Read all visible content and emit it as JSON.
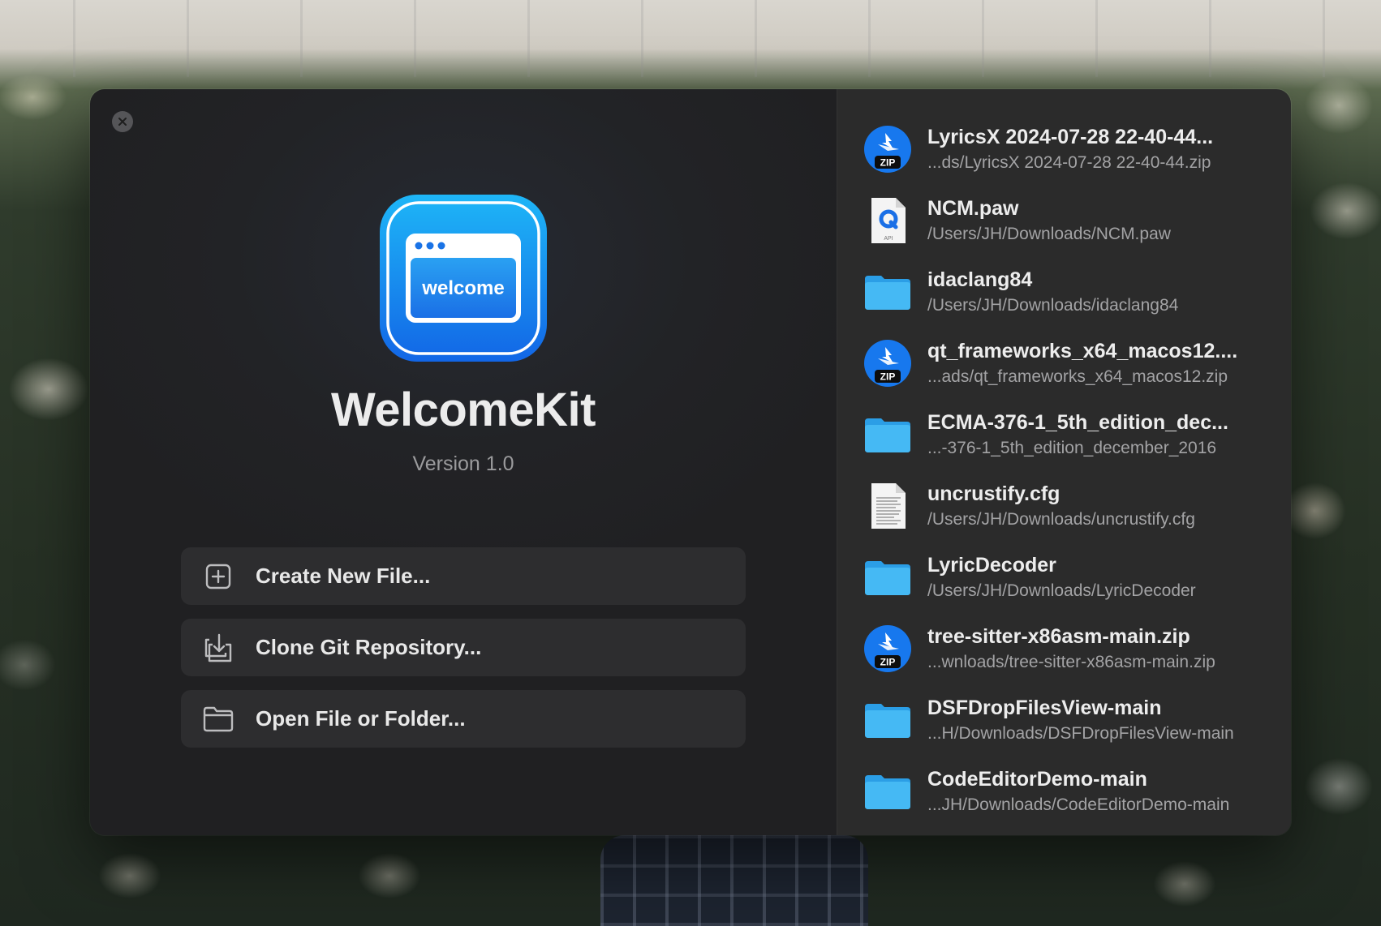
{
  "app": {
    "title": "WelcomeKit",
    "version": "Version 1.0",
    "icon_text": "welcome"
  },
  "actions": [
    {
      "label": "Create New File...",
      "icon": "plus-square-icon"
    },
    {
      "label": "Clone Git Repository...",
      "icon": "download-tray-icon"
    },
    {
      "label": "Open File or Folder...",
      "icon": "folder-icon"
    }
  ],
  "recent": [
    {
      "name": "LyricsX 2024-07-28 22-40-44...",
      "path": "...ds/LyricsX 2024-07-28 22-40-44.zip",
      "icon": "zip-archive-icon",
      "badge": "ZIP"
    },
    {
      "name": "NCM.paw",
      "path": "/Users/JH/Downloads/NCM.paw",
      "icon": "paw-document-icon",
      "badge": "API"
    },
    {
      "name": "idaclang84",
      "path": "/Users/JH/Downloads/idaclang84",
      "icon": "folder-icon"
    },
    {
      "name": "qt_frameworks_x64_macos12....",
      "path": "...ads/qt_frameworks_x64_macos12.zip",
      "icon": "zip-archive-icon",
      "badge": "ZIP"
    },
    {
      "name": "ECMA-376-1_5th_edition_dec...",
      "path": "...-376-1_5th_edition_december_2016",
      "icon": "folder-icon"
    },
    {
      "name": "uncrustify.cfg",
      "path": "/Users/JH/Downloads/uncrustify.cfg",
      "icon": "text-document-icon"
    },
    {
      "name": "LyricDecoder",
      "path": "/Users/JH/Downloads/LyricDecoder",
      "icon": "folder-icon"
    },
    {
      "name": "tree-sitter-x86asm-main.zip",
      "path": "...wnloads/tree-sitter-x86asm-main.zip",
      "icon": "zip-archive-icon",
      "badge": "ZIP"
    },
    {
      "name": "DSFDropFilesView-main",
      "path": "...H/Downloads/DSFDropFilesView-main",
      "icon": "folder-icon"
    },
    {
      "name": "CodeEditorDemo-main",
      "path": "...JH/Downloads/CodeEditorDemo-main",
      "icon": "folder-icon"
    }
  ],
  "colors": {
    "accent": "#1a8cf0",
    "folder": "#3ab0f0",
    "window_left": "#222326",
    "window_right": "#2b2b2b"
  }
}
